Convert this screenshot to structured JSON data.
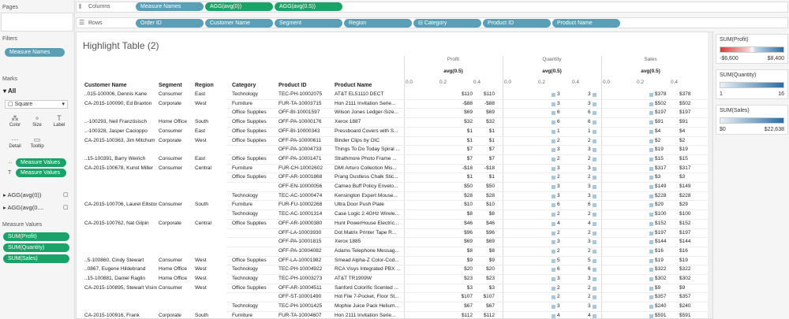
{
  "pages": {
    "title": "Pages"
  },
  "filters": {
    "title": "Filters",
    "pill": "Measure Names"
  },
  "marks": {
    "title": "Marks",
    "all_label": "All",
    "mark_type": "Square",
    "buttons": [
      "Color",
      "Size",
      "Label",
      "Detail",
      "Tooltip"
    ],
    "pills": [
      "Measure Values",
      "Measure Values"
    ],
    "agg1": "AGG(avg(0))",
    "agg2": "AGG(avg(0...."
  },
  "measure_values": {
    "title": "Measure Values",
    "items": [
      "SUM(Profit)",
      "SUM(Quantity)",
      "SUM(Sales)"
    ]
  },
  "shelves": {
    "columns_label": "Columns",
    "rows_label": "Rows",
    "columns": [
      "Measure Names",
      "AGG(avg(0))",
      "AGG(avg(0.5))"
    ],
    "rows": [
      "Order ID",
      "Customer Name",
      "Segment",
      "Region",
      "⊟ Category",
      "Product ID",
      "Product Name"
    ]
  },
  "sheet": {
    "title": "Highlight Table (2)",
    "measure_headers": [
      "Profit",
      "Quantity",
      "Sales"
    ],
    "avg_label": "avg(0.5)",
    "axis_ticks": [
      "0.0",
      "0.2",
      "0.4"
    ],
    "col_headers": [
      "Customer Name",
      "Segment",
      "Region",
      "Category",
      "Product ID",
      "Product Name"
    ],
    "rows": [
      [
        "..015-100006, Dennis Kane",
        "Consumer",
        "East",
        "Technology",
        "TEC-PH-10002075",
        "AT&T EL51110 DECT",
        "$110",
        "3",
        "$378"
      ],
      [
        "CA-2015-100090, Ed Braxton",
        "Corporate",
        "West",
        "Furniture",
        "FUR-TA-10003715",
        "Hon 2111 Invitation Serie...",
        "-$88",
        "3",
        "$502"
      ],
      [
        "",
        "",
        "",
        "Office Supplies",
        "OFF-BI-10001597",
        "Wilson Jones Ledger-Size...",
        "$69",
        "6",
        "$197"
      ],
      [
        "..-100293, Neil Französisch",
        "Home Office",
        "South",
        "Office Supplies",
        "OFF-PA-10000176",
        "Xerox 1887",
        "$32",
        "6",
        "$91"
      ],
      [
        "..-100328, Jasper Cacioppo",
        "Consumer",
        "East",
        "Office Supplies",
        "OFF-BI-10000343",
        "Pressboard Covers with S...",
        "$1",
        "1",
        "$4"
      ],
      [
        "CA-2015-100363, Jim Mitchum",
        "Corporate",
        "West",
        "Office Supplies",
        "OFF-PA-10000611",
        "Binder Clips by OIC",
        "$1",
        "2",
        "$2"
      ],
      [
        "",
        "",
        "",
        "",
        "OFF-PA-10004733",
        "Things To Do Today Spiral ...",
        "$7",
        "3",
        "$19"
      ],
      [
        "..15-100391, Barry Weirich",
        "Consumer",
        "East",
        "Office Supplies",
        "OFF-PA-10001471",
        "Strathmore Photo Frame ...",
        "$7",
        "2",
        "$15"
      ],
      [
        "CA-2015-100678, Kunst Miller",
        "Consumer",
        "Central",
        "Furniture",
        "FUR-CH-10002602",
        "DMI Arturo Collection Mis...",
        "-$18",
        "3",
        "$317"
      ],
      [
        "",
        "",
        "",
        "Office Supplies",
        "OFF-AR-10001868",
        "Prang Dustless Chalk Stic...",
        "$1",
        "2",
        "$3"
      ],
      [
        "",
        "",
        "",
        "",
        "OFF-EN-10000056",
        "Cameo Buff Policy Envelo...",
        "$50",
        "3",
        "$149"
      ],
      [
        "",
        "",
        "",
        "Technology",
        "TEC-AC-10000474",
        "Kensington Expert Mouse...",
        "$28",
        "3",
        "$228"
      ],
      [
        "CA-2015-100706, Laurel Elliston",
        "Consumer",
        "South",
        "Furniture",
        "FUR-FU-10002268",
        "Ultra Door Push Plate",
        "$10",
        "6",
        "$29"
      ],
      [
        "",
        "",
        "",
        "Technology",
        "TEC-AC-10001314",
        "Case Logic 2.4GHz Wirele...",
        "$8",
        "2",
        "$100"
      ],
      [
        "CA-2015-100762, Nat Gilpin",
        "Corporate",
        "Central",
        "Office Supplies",
        "OFF-AR-10000380",
        "Hunt PowerHouse Electric...",
        "$46",
        "4",
        "$152"
      ],
      [
        "",
        "",
        "",
        "",
        "OFF-LA-10003930",
        "Dot Matrix Printer Tape R...",
        "$96",
        "2",
        "$197"
      ],
      [
        "",
        "",
        "",
        "",
        "OFF-PA-10001815",
        "Xerox 1885",
        "$69",
        "3",
        "$144"
      ],
      [
        "",
        "",
        "",
        "",
        "OFF-PA-10004082",
        "Adams Telephone Messag...",
        "$8",
        "2",
        "$16"
      ],
      [
        "..5-100860, Cindy Stewart",
        "Consumer",
        "West",
        "Office Supplies",
        "OFF-LA-10001982",
        "Smead Alpha-Z Color-Cod...",
        "$9",
        "5",
        "$19"
      ],
      [
        "..0867, Eugene Hildebrand",
        "Home Office",
        "West",
        "Technology",
        "TEC-PH-10004922",
        "RCA Visys Integrated PBX ...",
        "$20",
        "6",
        "$322"
      ],
      [
        "..15-100881, Daniel Raglin",
        "Home Office",
        "West",
        "Technology",
        "TEC-PH-10003273",
        "AT&T TR1909W",
        "$23",
        "3",
        "$302"
      ],
      [
        "CA-2015-100895, Stewart Visinsky",
        "Consumer",
        "West",
        "Office Supplies",
        "OFF-AR-10004511",
        "Sanford Colorific Scented ...",
        "$3",
        "2",
        "$9"
      ],
      [
        "",
        "",
        "",
        "",
        "OFF-ST-10001490",
        "Hot File 7-Pocket, Floor St...",
        "$107",
        "2",
        "$357"
      ],
      [
        "",
        "",
        "",
        "Technology",
        "TEC-PH-10001425",
        "Mophie Juice Pack Helium...",
        "$67",
        "3",
        "$240"
      ],
      [
        "CA-2015-100916, Frank",
        "Corporate",
        "South",
        "Furniture",
        "FUR-TA-10004607",
        "Hon 2111 Invitation Serie...",
        "$112",
        "4",
        "$591"
      ]
    ]
  },
  "legends": {
    "profit": {
      "title": "SUM(Profit)",
      "min": "-$6,600",
      "max": "$8,400"
    },
    "quantity": {
      "title": "SUM(Quantity)",
      "min": "1",
      "max": "16"
    },
    "sales": {
      "title": "SUM(Sales)",
      "min": "$0",
      "max": "$22,638"
    }
  }
}
